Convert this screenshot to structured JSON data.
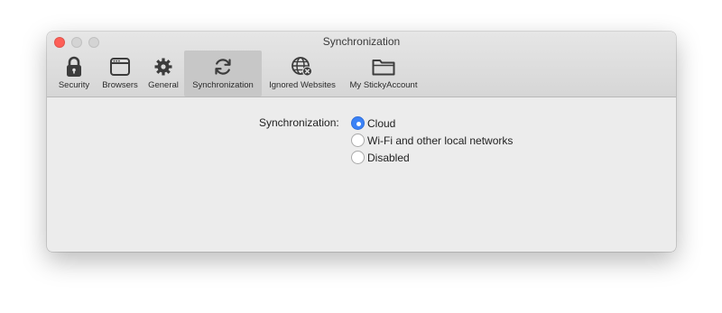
{
  "window": {
    "title": "Synchronization",
    "colors": {
      "close": "#fe5f57",
      "inactive_light": "#d4d4d4",
      "accent": "#3b82f6"
    }
  },
  "toolbar": {
    "items": [
      {
        "label": "Security",
        "icon": "lock-icon",
        "selected": false
      },
      {
        "label": "Browsers",
        "icon": "browser-window-icon",
        "selected": false
      },
      {
        "label": "General",
        "icon": "gear-icon",
        "selected": false
      },
      {
        "label": "Synchronization",
        "icon": "sync-icon",
        "selected": true
      },
      {
        "label": "Ignored Websites",
        "icon": "globe-blocked-icon",
        "selected": false
      },
      {
        "label": "My StickyAccount",
        "icon": "folder-icon",
        "selected": false
      }
    ]
  },
  "settings": {
    "sync_label": "Synchronization:",
    "options": [
      {
        "label": "Cloud",
        "selected": true
      },
      {
        "label": "Wi-Fi and other local networks",
        "selected": false
      },
      {
        "label": "Disabled",
        "selected": false
      }
    ]
  }
}
